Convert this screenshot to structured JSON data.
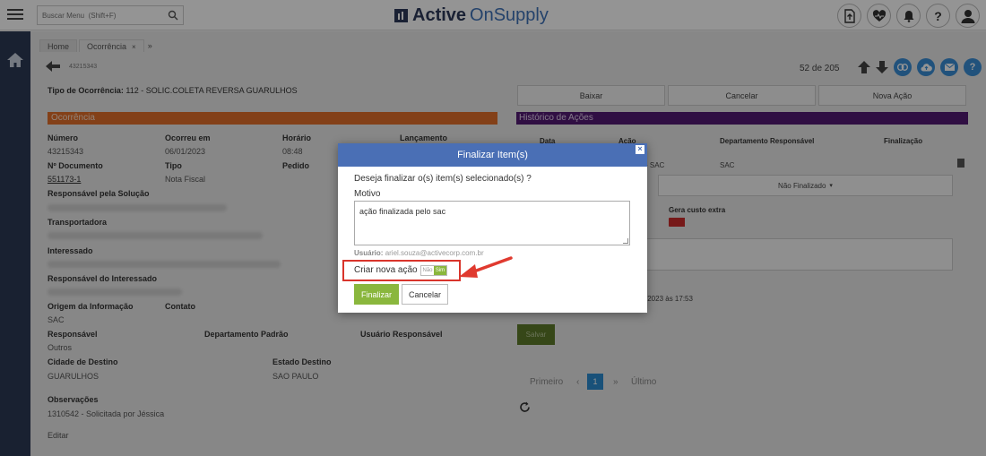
{
  "topbar": {
    "search_placeholder": "Buscar Menu  (Shift+F)",
    "logo_bold": "Active",
    "logo_light": "OnSupply",
    "help_label": "?"
  },
  "tabs": [
    {
      "label": "Home"
    },
    {
      "label": "Ocorrência",
      "close": "×"
    }
  ],
  "tabs_more": "»",
  "occurrence_id": "43215343",
  "pager_top": "52 de 205",
  "tipo": {
    "label": "Tipo de Ocorrência:",
    "value": "112 - SOLIC.COLETA REVERSA GUARULHOS"
  },
  "section_left": "Ocorrência",
  "section_right": "Histórico de Ações",
  "fields": {
    "numero_label": "Número",
    "numero_value": "43215343",
    "ocorreu_label": "Ocorreu em",
    "ocorreu_value": "06/01/2023",
    "horario_label": "Horário",
    "horario_value": "08:48",
    "lancamento_label": "Lançamento",
    "ndoc_label": "Nº Documento",
    "ndoc_value": "551173-1",
    "tipo_label": "Tipo",
    "tipo_value": "Nota Fiscal",
    "pedido_label": "Pedido",
    "resp_solucao_label": "Responsável pela Solução",
    "transportadora_label": "Transportadora",
    "interessado_label": "Interessado",
    "resp_interessado_label": "Responsável do Interessado",
    "origem_label": "Origem da Informação",
    "origem_value": "SAC",
    "contato_label": "Contato",
    "responsavel_label": "Responsável",
    "responsavel_value": "Outros",
    "depto_padrao_label": "Departamento Padrão",
    "usuario_resp_label": "Usuário Responsável",
    "cidade_label": "Cidade de Destino",
    "cidade_value": "GUARULHOS",
    "estado_label": "Estado Destino",
    "estado_value": "SAO PAULO",
    "obs_label": "Observações",
    "obs_value": "1310542 - Solicitada por Jéssica",
    "editar": "Editar"
  },
  "right": {
    "buttons": [
      "Baixar",
      "Cancelar",
      "Nova Ação"
    ],
    "headers": [
      "Data",
      "Ação",
      "Departamento Responsável",
      "Finalização"
    ],
    "row_acao_tail": "- SAC",
    "row_depto": "SAC",
    "dropdown": "Não Finalizado",
    "gera_custo": "Gera custo extra",
    "timestamp_tail": "/2023 às 17:53",
    "salvar": "Salvar",
    "pag_first": "Primeiro",
    "pag_prev": "‹",
    "pag_current": "1",
    "pag_next": "»",
    "pag_last": "Último"
  },
  "modal": {
    "title": "Finalizar Item(s)",
    "close": "×",
    "question": "Deseja finalizar o(s) item(s) selecionado(s) ?",
    "motivo_label": "Motivo",
    "motivo_value": "ação finalizada pelo sac",
    "usuario_label": "Usuário:",
    "usuario_value": "ariel.souza@activecorp.com.br",
    "criar_label": "Criar nova ação",
    "toggle_off": "Não",
    "toggle_on": "Sim",
    "finalizar": "Finalizar",
    "cancelar": "Cancelar"
  },
  "colors": {
    "modal_header": "#4a6fb5",
    "accent_green": "#8ab73d",
    "section_orange": "#e26e2a",
    "section_purple": "#531b74",
    "highlight_red": "#d9342b"
  }
}
